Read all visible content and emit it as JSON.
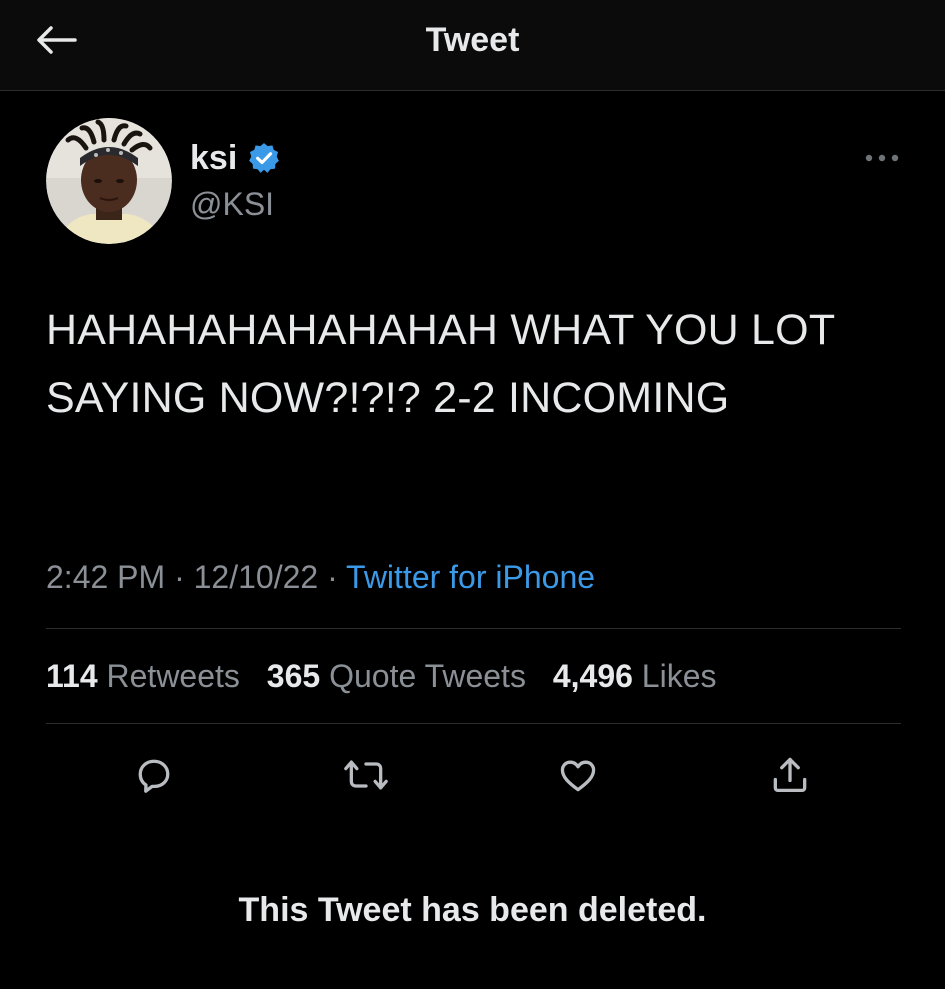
{
  "header": {
    "title": "Tweet",
    "back_icon": "arrow-left-icon"
  },
  "author": {
    "display_name": "ksi",
    "handle": "@KSI",
    "verified": true,
    "verified_icon": "verified-badge-icon"
  },
  "tweet": {
    "text": "HAHAHAHAHAHAHAH WHAT YOU LOT SAYING NOW?!?!? 2-2 INCOMING",
    "time": "2:42 PM",
    "separator": "·",
    "date": "12/10/22",
    "source": "Twitter for iPhone"
  },
  "stats": {
    "retweets_count": "114",
    "retweets_label": "Retweets",
    "quote_tweets_count": "365",
    "quote_tweets_label": "Quote Tweets",
    "likes_count": "4,496",
    "likes_label": "Likes"
  },
  "actions": [
    "reply-icon",
    "retweet-icon",
    "like-icon",
    "share-icon"
  ],
  "deleted_notice": "This Tweet has been deleted.",
  "colors": {
    "background": "#000000",
    "text": "#e7e9ea",
    "secondary_text": "#8b9096",
    "accent": "#3b9ae8",
    "divider": "#2a2d30"
  }
}
